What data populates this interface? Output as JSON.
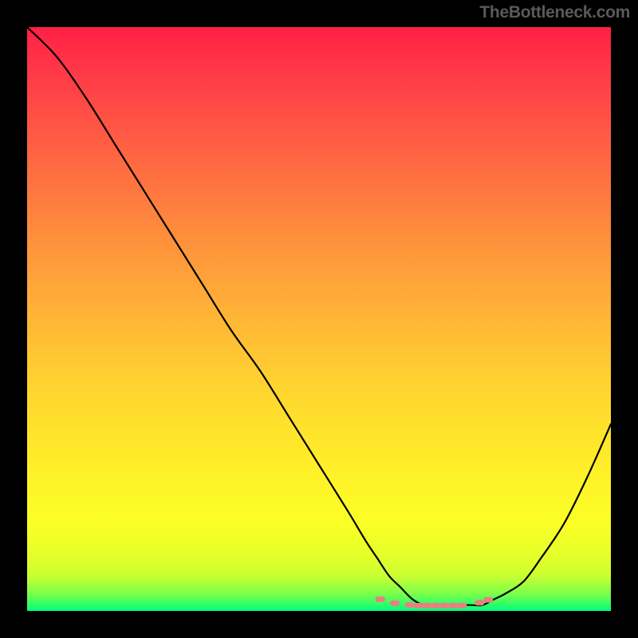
{
  "attribution": "TheBottleneck.com",
  "chart_data": {
    "type": "line",
    "title": "",
    "xlabel": "",
    "ylabel": "",
    "x_range": [
      0,
      100
    ],
    "y_range": [
      0,
      100
    ],
    "series": [
      {
        "name": "bottleneck-curve",
        "x": [
          0,
          5,
          10,
          15,
          20,
          25,
          30,
          35,
          40,
          45,
          50,
          55,
          58,
          60,
          62,
          64,
          66,
          68,
          70,
          72,
          74,
          76,
          78,
          80,
          82,
          85,
          88,
          92,
          96,
          100
        ],
        "values": [
          100,
          95,
          88,
          80,
          72,
          64,
          56,
          48,
          41,
          33,
          25,
          17,
          12,
          9,
          6,
          4,
          2,
          1,
          1,
          1,
          1,
          1,
          1,
          2,
          3,
          5,
          9,
          15,
          23,
          32
        ]
      }
    ],
    "markers": {
      "name": "valley-markers",
      "x": [
        60.5,
        63.0,
        65.5,
        67.0,
        68.5,
        70.0,
        71.5,
        73.0,
        74.5,
        77.5,
        79.0
      ],
      "values": [
        2.0,
        1.3,
        1.0,
        0.9,
        0.9,
        0.9,
        0.9,
        0.9,
        0.9,
        1.4,
        1.9
      ]
    },
    "background": {
      "type": "vertical-gradient",
      "stops": [
        {
          "pos": 0,
          "color": "#ff1f46"
        },
        {
          "pos": 50,
          "color": "#ffb636"
        },
        {
          "pos": 85,
          "color": "#fbff26"
        },
        {
          "pos": 100,
          "color": "#00ff88"
        }
      ]
    }
  }
}
